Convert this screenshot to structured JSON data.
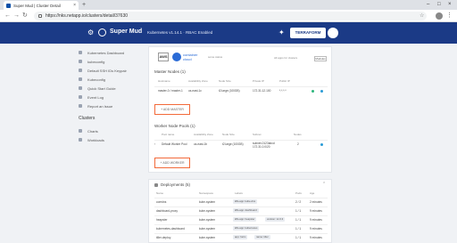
{
  "browser": {
    "tab_title": "Super Mud | Cluster Detail",
    "url": "https://nks.netapp.io/clusters/detail/37630"
  },
  "header": {
    "brand": "Super Mud",
    "cluster_info": "Kubernetes v1.14.1 · RBAC Enabled",
    "terraform_label": "TERRAFORM"
  },
  "sidebar": {
    "items": [
      "Kubernetes Dashboard",
      "kubeconfig",
      "Default SSH IDs Keypair",
      "Kubeconfig",
      "Quick Start Guide",
      "Event Log",
      "Report an Issue"
    ],
    "section_heading": "Clusters",
    "sub_items": [
      "Charts",
      "Workloads"
    ]
  },
  "provider": {
    "aws_label": "AWS",
    "name_line1": "container",
    "name_line2": "cloud",
    "status_text": "some status",
    "all_apps_text": "All apps for clusters",
    "dropdown_value": "Modules"
  },
  "master": {
    "title": "Master Nodes (1)",
    "headers": [
      "Hostname",
      "Availability Zone",
      "Node Size",
      "Private IP",
      "Public IP",
      "",
      ""
    ],
    "rows": [
      {
        "hostname": "master-0 / master-1",
        "zone": "us-east-1c",
        "size": "t2.large (100GB)",
        "private_ip": "172.31.12.100",
        "public_ip": "*.*.*.*"
      }
    ],
    "add_button": "+ ADD MASTER"
  },
  "workers": {
    "title": "Worker Node Pools (1)",
    "headers": [
      "Pool name",
      "Availability Zone",
      "Node Size",
      "Subnet",
      "Nodes",
      ""
    ],
    "rows": [
      {
        "name": "Default Worker Pool",
        "zone": "us-east-1b",
        "size": "t2.large (100GB)",
        "subnet": "subnet-0123abcd",
        "subnet2": "172.31.0.0/20",
        "nodes": "2"
      }
    ],
    "add_button": "+ ADD WORKER"
  },
  "deployments": {
    "title": "Deployments (5)",
    "headers": [
      "Name",
      "Namespace",
      "Labels",
      "Pods",
      "Age"
    ],
    "rows": [
      {
        "name": "coredns",
        "namespace": "kube-system",
        "labels": [
          "k8s-app: kube-dns"
        ],
        "pods": "2 / 2",
        "age": "2 minutes"
      },
      {
        "name": "dashboard-proxy",
        "namespace": "kube-system",
        "labels": [
          "k8s-app: dashboard"
        ],
        "pods": "1 / 1",
        "age": "9 minutes"
      },
      {
        "name": "heapster",
        "namespace": "kube-system",
        "labels": [
          "k8s-app: heapster",
          "version: v1.6.3"
        ],
        "pods": "1 / 1",
        "age": "9 minutes"
      },
      {
        "name": "kubernetes-dashboard",
        "namespace": "kube-system",
        "labels": [
          "k8s-app: kubernetes"
        ],
        "pods": "1 / 1",
        "age": "9 minutes"
      },
      {
        "name": "tiller-deploy",
        "namespace": "kube-system",
        "labels": [
          "app: helm",
          "name: tiller"
        ],
        "pods": "1 / 1",
        "age": "9 minutes"
      }
    ]
  },
  "colors": {
    "header_bg": "#1b3a86",
    "accent": "#f26a3a",
    "status_green": "#2db67c"
  }
}
